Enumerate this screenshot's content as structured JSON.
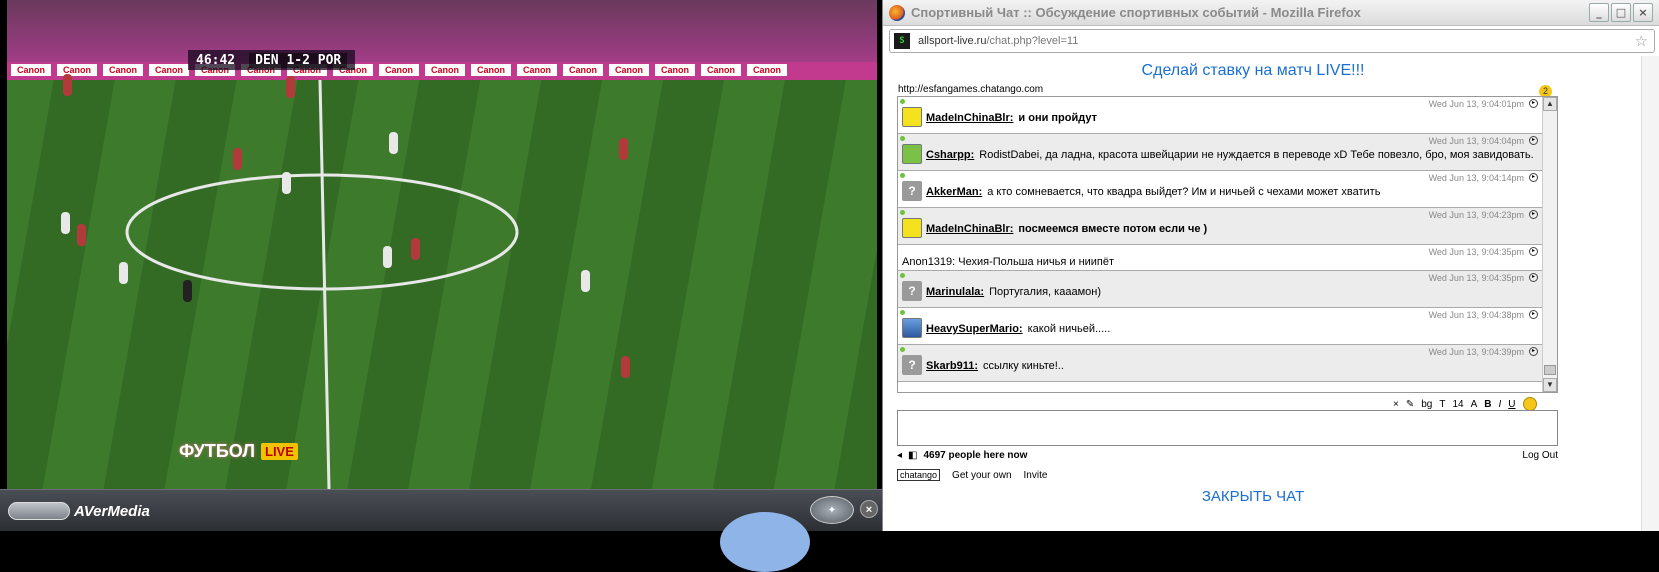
{
  "player": {
    "scorebug": {
      "clock": "46:42",
      "score": "DEN 1-2 POR"
    },
    "board_text": "Canon",
    "channel": {
      "name": "ФУТБОЛ",
      "live_badge": "LIVE"
    },
    "brand": "AVerMedia",
    "close_label": "×"
  },
  "firefox": {
    "window_title": "Спортивный Чат :: Обсуждение спортивных событий - Mozilla Firefox",
    "url_host": "allsport-live.ru",
    "url_path": "/chat.php?level=11",
    "site_icon_text": "S"
  },
  "page": {
    "promo_link": "Сделай ставку на матч LIVE!!!",
    "topic_url": "http://esfangames.chatango.com",
    "unread_count": "2",
    "messages": [
      {
        "user": "MadeInChinaBlr:",
        "text": "и они пройдут",
        "bold": true,
        "time": "Wed Jun 13, 9:04:01pm",
        "avatar": "yellow",
        "alt": false
      },
      {
        "user": "Csharpp:",
        "text": "RodistDabei, да ладна, красота швейцарии не нуждается в переводе xD Тебе повезло, бро, моя завидовать.",
        "bold": false,
        "time": "Wed Jun 13, 9:04:04pm",
        "avatar": "green",
        "alt": true
      },
      {
        "user": "AkkerMan:",
        "text": "а кто сомневается, что квадра выйдет? Им и ничьей с чехами может хватить",
        "bold": false,
        "time": "Wed Jun 13, 9:04:14pm",
        "avatar": "unknown",
        "alt": false
      },
      {
        "user": "MadeInChinaBlr:",
        "text": "посмеемся вместе потом если че )",
        "bold": true,
        "time": "Wed Jun 13, 9:04:23pm",
        "avatar": "yellow",
        "alt": true
      },
      {
        "user": "",
        "text": "Anon1319: Чехия-Польша ничья и ниипёт",
        "bold": false,
        "time": "Wed Jun 13, 9:04:35pm",
        "avatar": "",
        "alt": false
      },
      {
        "user": "Marinulala:",
        "text": "Португалия, кааамон)",
        "bold": false,
        "time": "Wed Jun 13, 9:04:35pm",
        "avatar": "unknown",
        "alt": true
      },
      {
        "user": "HeavySuperMario:",
        "text": "какой ничьей.....",
        "bold": false,
        "time": "Wed Jun 13, 9:04:38pm",
        "avatar": "photo",
        "alt": false
      },
      {
        "user": "Skarb911:",
        "text": "ссылку киньте!..",
        "bold": false,
        "time": "Wed Jun 13, 9:04:39pm",
        "avatar": "unknown",
        "alt": true
      }
    ],
    "format_bar": {
      "clear": "×",
      "bg": "bg",
      "font": "T",
      "size": "14",
      "bold": "B",
      "italic": "I",
      "underline": "U"
    },
    "people_count": "4697 people here now",
    "logout": "Log Out",
    "chatango_logo": "chatango",
    "get_your_own": "Get your own",
    "invite": "Invite",
    "close_chat": "ЗАКРЫТЬ ЧАТ"
  }
}
